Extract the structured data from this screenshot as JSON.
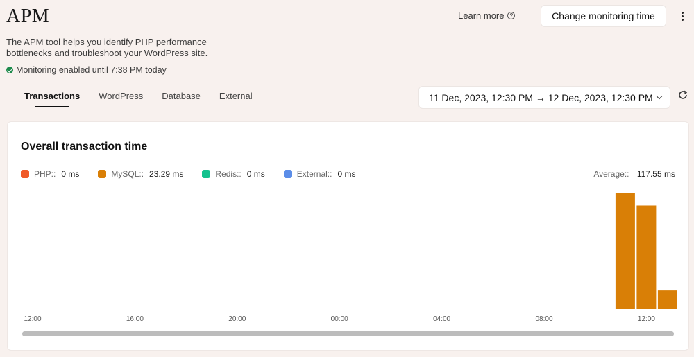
{
  "header": {
    "title": "APM",
    "description": "The APM tool helps you identify PHP performance bottlenecks and troubleshoot your WordPress site.",
    "status": "Monitoring enabled until 7:38 PM today",
    "learn_more": "Learn more",
    "change_button": "Change monitoring time"
  },
  "tabs": [
    {
      "label": "Transactions",
      "active": true
    },
    {
      "label": "WordPress",
      "active": false
    },
    {
      "label": "Database",
      "active": false
    },
    {
      "label": "External",
      "active": false
    }
  ],
  "date_range": "11 Dec, 2023, 12:30 PM → 12 Dec, 2023, 12:30 PM",
  "card": {
    "title": "Overall transaction time",
    "legend": [
      {
        "label": "PHP::",
        "value": "0 ms",
        "color": "#f05a28"
      },
      {
        "label": "MySQL::",
        "value": "23.29 ms",
        "color": "#d97f06"
      },
      {
        "label": "Redis::",
        "value": "0 ms",
        "color": "#14c28e"
      },
      {
        "label": "External::",
        "value": "0 ms",
        "color": "#5b8de8"
      }
    ],
    "average_label": "Average::",
    "average_value": "117.55 ms"
  },
  "chart_data": {
    "type": "bar",
    "x_ticks": [
      "12:00",
      "16:00",
      "20:00",
      "00:00",
      "04:00",
      "08:00",
      "12:00"
    ],
    "series": [
      {
        "name": "MySQL::",
        "color": "#d97f06",
        "bars": [
          {
            "x": "11:00",
            "value": 100
          },
          {
            "x": "12:00",
            "value": 89
          },
          {
            "x": "13:00",
            "value": 16
          }
        ]
      }
    ]
  }
}
